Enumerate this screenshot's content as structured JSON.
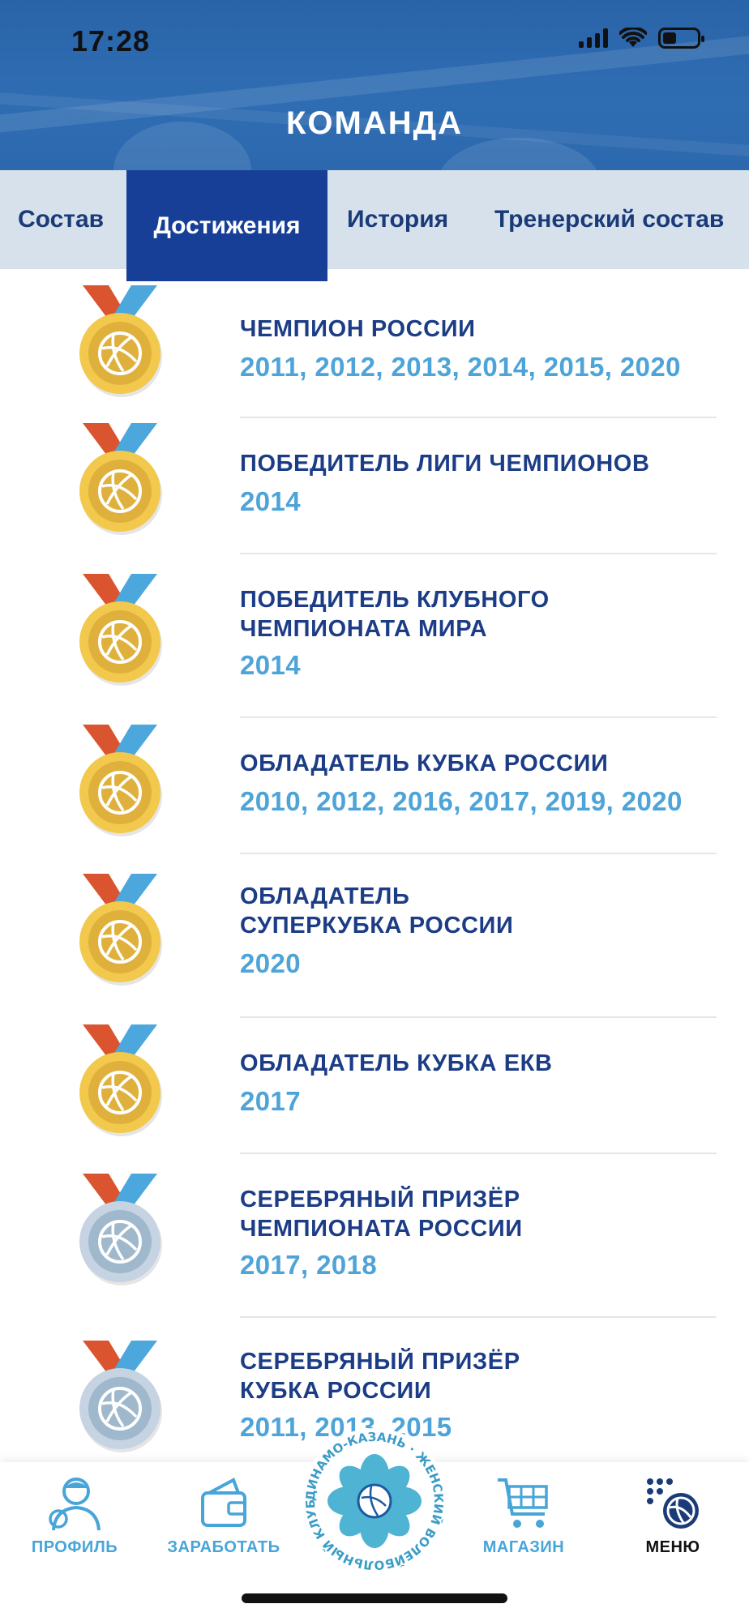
{
  "status_bar": {
    "time": "17:28"
  },
  "header": {
    "title": "КОМАНДА"
  },
  "tabs": [
    {
      "label": "Состав",
      "active": false
    },
    {
      "label": "Достижения",
      "active": true
    },
    {
      "label": "История",
      "active": false
    },
    {
      "label": "Тренерский состав",
      "active": false
    }
  ],
  "achievements": [
    {
      "medal": "gold-medal-icon",
      "title": "ЧЕМПИОН РОССИИ",
      "years": "2011, 2012, 2013, 2014, 2015, 2020"
    },
    {
      "medal": "gold-medal-icon",
      "title": "ПОБЕДИТЕЛЬ ЛИГИ ЧЕМПИОНОВ",
      "years": "2014"
    },
    {
      "medal": "gold-medal-icon",
      "title": "ПОБЕДИТЕЛЬ КЛУБНОГО\nЧЕМПИОНАТА МИРА",
      "years": "2014"
    },
    {
      "medal": "gold-medal-icon",
      "title": "ОБЛАДАТЕЛЬ КУБКА РОССИИ",
      "years": "2010, 2012, 2016, 2017, 2019, 2020"
    },
    {
      "medal": "gold-medal-icon",
      "title": "ОБЛАДАТЕЛЬ\nСУПЕРКУБКА РОССИИ",
      "years": "2020"
    },
    {
      "medal": "gold-medal-icon",
      "title": "ОБЛАДАТЕЛЬ КУБКА ЕКВ",
      "years": "2017"
    },
    {
      "medal": "silver-medal-icon",
      "title": "СЕРЕБРЯНЫЙ ПРИЗЁР\nЧЕМПИОНАТА РОССИИ",
      "years": "2017, 2018"
    },
    {
      "medal": "silver-medal-icon",
      "title": "СЕРЕБРЯНЫЙ ПРИЗЁР\nКУБКА РОССИИ",
      "years": "2011, 2013, 2015"
    }
  ],
  "bottom_nav": {
    "items": [
      {
        "label": "ПРОФИЛЬ",
        "icon": "profile-icon"
      },
      {
        "label": "ЗАРАБОТАТЬ",
        "icon": "wallet-icon"
      },
      {
        "label": "МАГАЗИН",
        "icon": "cart-icon"
      },
      {
        "label": "МЕНЮ",
        "icon": "menu-icon"
      }
    ],
    "logo_text": "ДИНАМО-КАЗАНЬ · ЖЕНСКИЙ ВОЛЕЙБОЛЬНЫЙ КЛУБ ·"
  },
  "colors": {
    "header_blue": "#2f6db3",
    "tab_active": "#173f97",
    "title_navy": "#1c3d86",
    "years_blue": "#4ea4d8",
    "nav_label": "#47a5d8",
    "gold": "#f1c84a",
    "silver": "#b8cad9"
  }
}
